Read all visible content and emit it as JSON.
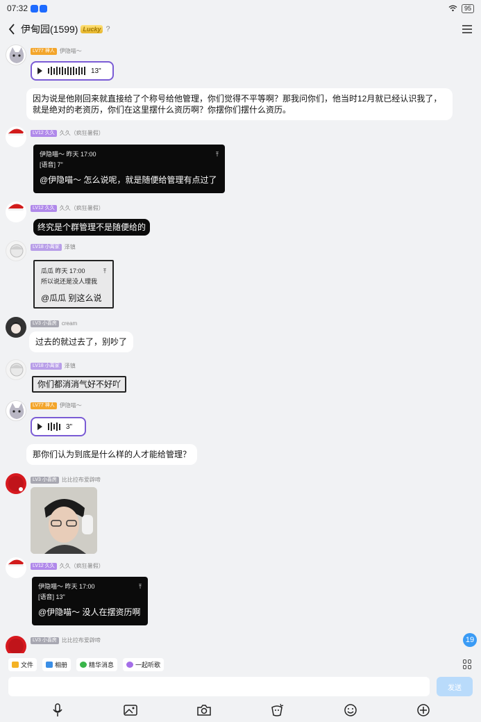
{
  "status": {
    "time": "07:32",
    "battery": "95"
  },
  "header": {
    "title": "伊甸园(1599)",
    "badge": "Lucky",
    "help": "?"
  },
  "messages": {
    "m1": {
      "level": "LV77 神人",
      "name": "伊隐喵～",
      "duration": "13\""
    },
    "m2": {
      "text": "因为说是他刚回来就直接给了个称号给他管理，你们觉得不平等啊？那我问你们，他当时12月就已经认识我了，就是绝对的老资历，你们在这里摆什么资历啊？你摆你们摆什么资历。"
    },
    "m3": {
      "level": "LV12 久久",
      "name": "久久（疯狂暑假）",
      "quote_head": "伊隐喵～ 昨天 17:00",
      "quote_body": "[语音] 7\"",
      "text": "@伊隐喵～ 怎么说呢，就是随便给管理有点过了"
    },
    "m4": {
      "level": "LV12 久久",
      "name": "久久（疯狂暑假）",
      "text": "终究是个群管理不是随便给的"
    },
    "m5": {
      "level": "LV18 小离家",
      "name": "泽镇",
      "quote_head": "瓜瓜 昨天 17:00",
      "quote_body": "所以说还是没人理我",
      "text": "@瓜瓜 别这么说"
    },
    "m6": {
      "level": "LV3 小喜房",
      "name": "cream",
      "text": "过去的就过去了，别吵了"
    },
    "m7": {
      "level": "LV18 小离家",
      "name": "泽镇",
      "text": "你们都消消气好不好吖"
    },
    "m8": {
      "level": "LV77 神人",
      "name": "伊隐喵～",
      "duration": "3\""
    },
    "m9": {
      "text": "那你们认为到底是什么样的人才能给管理？"
    },
    "m10": {
      "level": "LV3 小喜房",
      "name": "比比拉布爱辟啼"
    },
    "m11": {
      "level": "LV12 久久",
      "name": "久久（疯狂暑假）",
      "quote_head": "伊隐喵～ 昨天 17:00",
      "quote_body": "[语音] 13\"",
      "text": "@伊隐喵～ 没人在摆资历啊"
    },
    "m12": {
      "level": "LV3 小喜房",
      "name": "比比拉布爱辟啼"
    }
  },
  "unread_count": "19",
  "toolbar": {
    "file": "文件",
    "album": "相册",
    "essence": "精华消息",
    "listen": "一起听歌"
  },
  "input": {
    "placeholder": "",
    "send": "发送"
  },
  "colors": {
    "accent": "#1e6bff",
    "voice_border": "#7a5bd5",
    "send_bg": "#b9dbfb"
  }
}
